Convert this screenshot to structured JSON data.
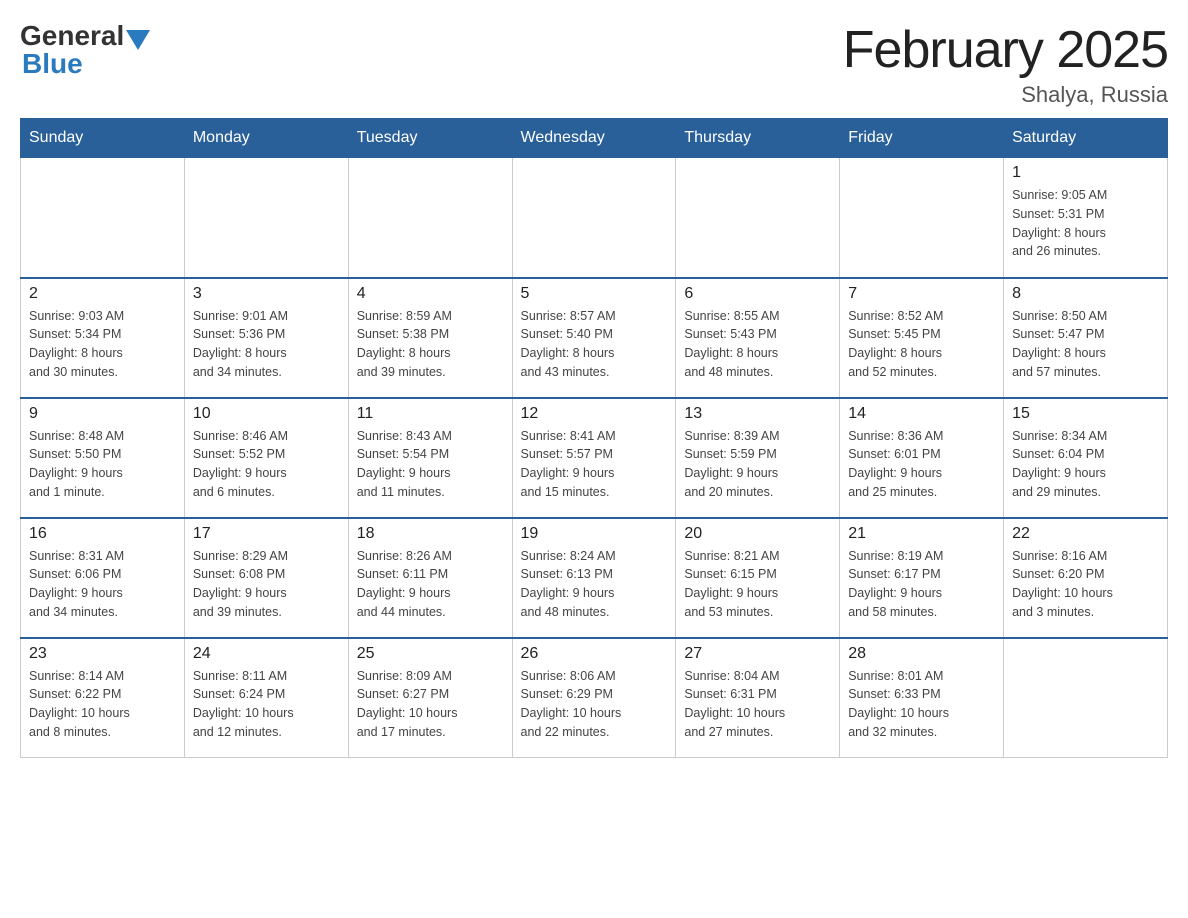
{
  "header": {
    "logo_general": "General",
    "logo_blue": "Blue",
    "title": "February 2025",
    "subtitle": "Shalya, Russia"
  },
  "days_of_week": [
    "Sunday",
    "Monday",
    "Tuesday",
    "Wednesday",
    "Thursday",
    "Friday",
    "Saturday"
  ],
  "weeks": [
    [
      {
        "day": "",
        "info": ""
      },
      {
        "day": "",
        "info": ""
      },
      {
        "day": "",
        "info": ""
      },
      {
        "day": "",
        "info": ""
      },
      {
        "day": "",
        "info": ""
      },
      {
        "day": "",
        "info": ""
      },
      {
        "day": "1",
        "info": "Sunrise: 9:05 AM\nSunset: 5:31 PM\nDaylight: 8 hours\nand 26 minutes."
      }
    ],
    [
      {
        "day": "2",
        "info": "Sunrise: 9:03 AM\nSunset: 5:34 PM\nDaylight: 8 hours\nand 30 minutes."
      },
      {
        "day": "3",
        "info": "Sunrise: 9:01 AM\nSunset: 5:36 PM\nDaylight: 8 hours\nand 34 minutes."
      },
      {
        "day": "4",
        "info": "Sunrise: 8:59 AM\nSunset: 5:38 PM\nDaylight: 8 hours\nand 39 minutes."
      },
      {
        "day": "5",
        "info": "Sunrise: 8:57 AM\nSunset: 5:40 PM\nDaylight: 8 hours\nand 43 minutes."
      },
      {
        "day": "6",
        "info": "Sunrise: 8:55 AM\nSunset: 5:43 PM\nDaylight: 8 hours\nand 48 minutes."
      },
      {
        "day": "7",
        "info": "Sunrise: 8:52 AM\nSunset: 5:45 PM\nDaylight: 8 hours\nand 52 minutes."
      },
      {
        "day": "8",
        "info": "Sunrise: 8:50 AM\nSunset: 5:47 PM\nDaylight: 8 hours\nand 57 minutes."
      }
    ],
    [
      {
        "day": "9",
        "info": "Sunrise: 8:48 AM\nSunset: 5:50 PM\nDaylight: 9 hours\nand 1 minute."
      },
      {
        "day": "10",
        "info": "Sunrise: 8:46 AM\nSunset: 5:52 PM\nDaylight: 9 hours\nand 6 minutes."
      },
      {
        "day": "11",
        "info": "Sunrise: 8:43 AM\nSunset: 5:54 PM\nDaylight: 9 hours\nand 11 minutes."
      },
      {
        "day": "12",
        "info": "Sunrise: 8:41 AM\nSunset: 5:57 PM\nDaylight: 9 hours\nand 15 minutes."
      },
      {
        "day": "13",
        "info": "Sunrise: 8:39 AM\nSunset: 5:59 PM\nDaylight: 9 hours\nand 20 minutes."
      },
      {
        "day": "14",
        "info": "Sunrise: 8:36 AM\nSunset: 6:01 PM\nDaylight: 9 hours\nand 25 minutes."
      },
      {
        "day": "15",
        "info": "Sunrise: 8:34 AM\nSunset: 6:04 PM\nDaylight: 9 hours\nand 29 minutes."
      }
    ],
    [
      {
        "day": "16",
        "info": "Sunrise: 8:31 AM\nSunset: 6:06 PM\nDaylight: 9 hours\nand 34 minutes."
      },
      {
        "day": "17",
        "info": "Sunrise: 8:29 AM\nSunset: 6:08 PM\nDaylight: 9 hours\nand 39 minutes."
      },
      {
        "day": "18",
        "info": "Sunrise: 8:26 AM\nSunset: 6:11 PM\nDaylight: 9 hours\nand 44 minutes."
      },
      {
        "day": "19",
        "info": "Sunrise: 8:24 AM\nSunset: 6:13 PM\nDaylight: 9 hours\nand 48 minutes."
      },
      {
        "day": "20",
        "info": "Sunrise: 8:21 AM\nSunset: 6:15 PM\nDaylight: 9 hours\nand 53 minutes."
      },
      {
        "day": "21",
        "info": "Sunrise: 8:19 AM\nSunset: 6:17 PM\nDaylight: 9 hours\nand 58 minutes."
      },
      {
        "day": "22",
        "info": "Sunrise: 8:16 AM\nSunset: 6:20 PM\nDaylight: 10 hours\nand 3 minutes."
      }
    ],
    [
      {
        "day": "23",
        "info": "Sunrise: 8:14 AM\nSunset: 6:22 PM\nDaylight: 10 hours\nand 8 minutes."
      },
      {
        "day": "24",
        "info": "Sunrise: 8:11 AM\nSunset: 6:24 PM\nDaylight: 10 hours\nand 12 minutes."
      },
      {
        "day": "25",
        "info": "Sunrise: 8:09 AM\nSunset: 6:27 PM\nDaylight: 10 hours\nand 17 minutes."
      },
      {
        "day": "26",
        "info": "Sunrise: 8:06 AM\nSunset: 6:29 PM\nDaylight: 10 hours\nand 22 minutes."
      },
      {
        "day": "27",
        "info": "Sunrise: 8:04 AM\nSunset: 6:31 PM\nDaylight: 10 hours\nand 27 minutes."
      },
      {
        "day": "28",
        "info": "Sunrise: 8:01 AM\nSunset: 6:33 PM\nDaylight: 10 hours\nand 32 minutes."
      },
      {
        "day": "",
        "info": ""
      }
    ]
  ]
}
